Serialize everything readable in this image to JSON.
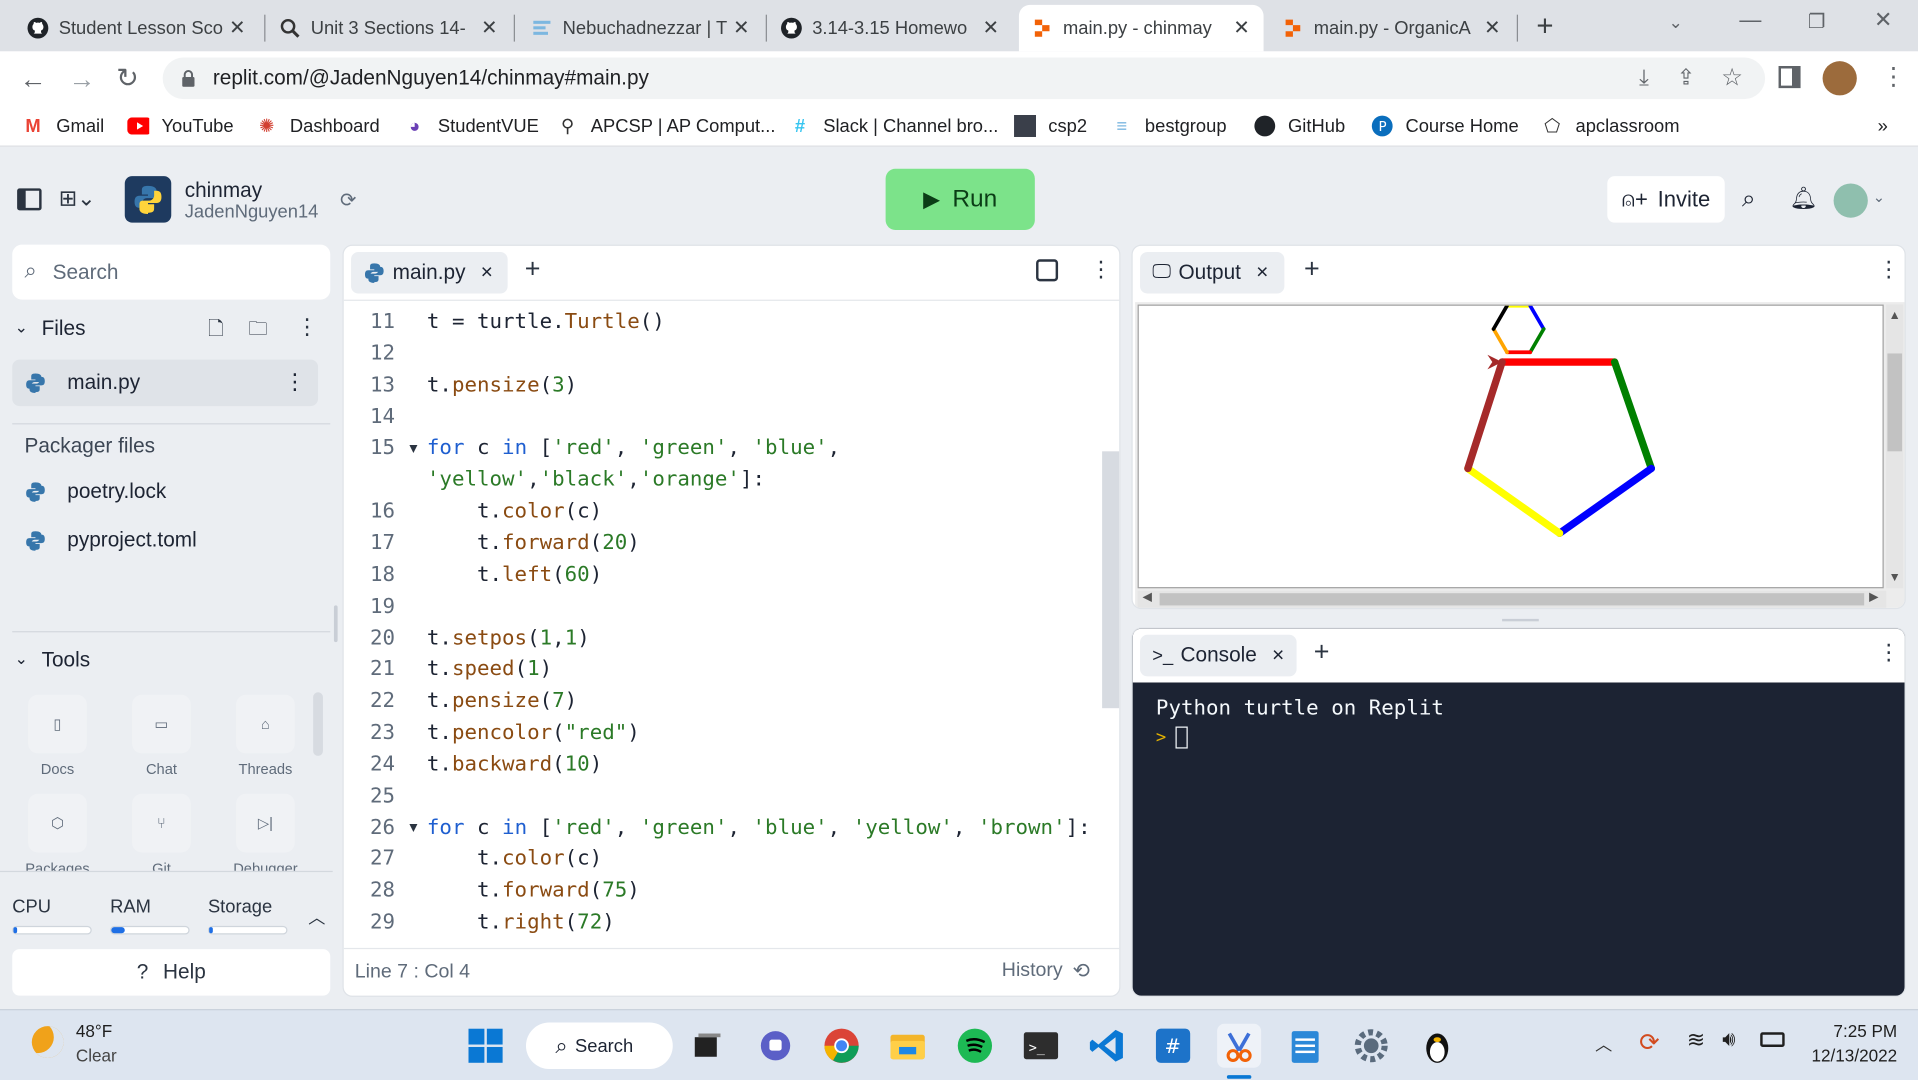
{
  "browser": {
    "tabs": [
      {
        "title": "Student Lesson Sco",
        "icon": "github-icon"
      },
      {
        "title": "Unit 3 Sections 14-",
        "icon": "search-doc-icon"
      },
      {
        "title": "Nebuchadnezzar | T",
        "icon": "doc-icon"
      },
      {
        "title": "3.14-3.15 Homewo",
        "icon": "github-icon"
      },
      {
        "title": "main.py - chinmay",
        "icon": "replit-icon",
        "active": true
      },
      {
        "title": "main.py - OrganicA",
        "icon": "replit-icon"
      }
    ],
    "url": "replit.com/@JadenNguyen14/chinmay#main.py",
    "bookmarks": [
      "Gmail",
      "YouTube",
      "Dashboard",
      "StudentVUE",
      "APCSP | AP Comput...",
      "Slack | Channel bro...",
      "csp2",
      "bestgroup",
      "GitHub",
      "Course Home",
      "apclassroom"
    ],
    "more": "»"
  },
  "repl": {
    "name": "chinmay",
    "owner": "JadenNguyen14",
    "run_label": "Run",
    "invite_label": "Invite"
  },
  "sidebar": {
    "search_placeholder": "Search",
    "files_header": "Files",
    "files": [
      "main.py"
    ],
    "packager_header": "Packager files",
    "packager_files": [
      "poetry.lock",
      "pyproject.toml"
    ],
    "tools_header": "Tools",
    "tools": [
      "Docs",
      "Chat",
      "Threads",
      "Packages",
      "Git",
      "Debugger"
    ],
    "usage": [
      {
        "label": "CPU",
        "fraction": 0.04
      },
      {
        "label": "RAM",
        "fraction": 0.18
      },
      {
        "label": "Storage",
        "fraction": 0.04
      }
    ],
    "help_label": "Help"
  },
  "editor": {
    "tab": "main.py",
    "status": "Line 7 : Col 4",
    "history_label": "History",
    "lines": [
      {
        "n": "11",
        "text": "t = turtle.Turtle()"
      },
      {
        "n": "12",
        "text": ""
      },
      {
        "n": "13",
        "text": "t.pensize(3)"
      },
      {
        "n": "14",
        "text": ""
      },
      {
        "n": "15",
        "text": "for c in ['red', 'green', 'blue',",
        "fold": true
      },
      {
        "n": "",
        "text": "'yellow','black','orange']:"
      },
      {
        "n": "16",
        "text": "    t.color(c)"
      },
      {
        "n": "17",
        "text": "    t.forward(20)"
      },
      {
        "n": "18",
        "text": "    t.left(60)"
      },
      {
        "n": "19",
        "text": ""
      },
      {
        "n": "20",
        "text": "t.setpos(1,1)"
      },
      {
        "n": "21",
        "text": "t.speed(1)"
      },
      {
        "n": "22",
        "text": "t.pensize(7)"
      },
      {
        "n": "23",
        "text": "t.pencolor(\"red\")"
      },
      {
        "n": "24",
        "text": "t.backward(10)"
      },
      {
        "n": "25",
        "text": ""
      },
      {
        "n": "26",
        "text": "for c in ['red', 'green', 'blue', 'yellow', 'brown']:",
        "fold": true
      },
      {
        "n": "27",
        "text": "    t.color(c)"
      },
      {
        "n": "28",
        "text": "    t.forward(75)"
      },
      {
        "n": "29",
        "text": "    t.right(72)"
      }
    ]
  },
  "output": {
    "tab": "Output",
    "pentagon_colors": [
      "#ff0000",
      "#008000",
      "#0000ff",
      "#ffff00",
      "#a52a2a"
    ],
    "hexagon_colors": [
      "#ff0000",
      "#008000",
      "#0000ff",
      "#ffff00",
      "#000000",
      "#ffa500"
    ]
  },
  "console": {
    "tab": "Console",
    "text": "Python turtle on Replit",
    "prompt": ">"
  },
  "taskbar": {
    "weather_temp": "48°F",
    "weather_desc": "Clear",
    "search_label": "Search",
    "time": "7:25 PM",
    "date": "12/13/2022"
  }
}
